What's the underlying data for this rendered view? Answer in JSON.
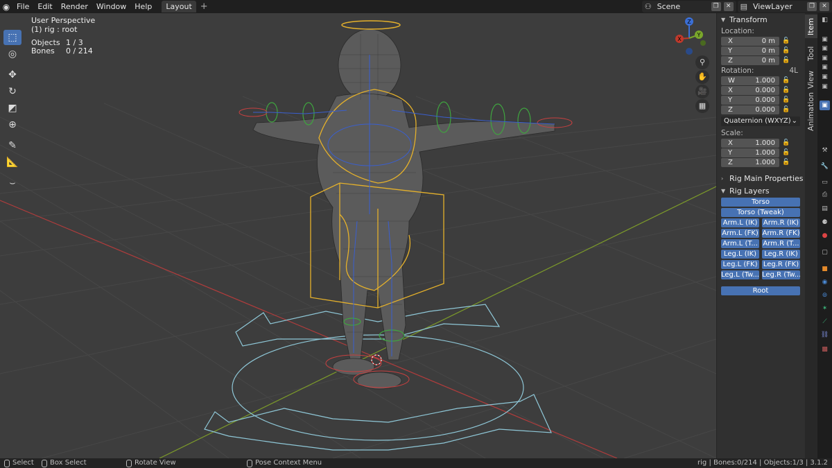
{
  "menu": {
    "items": [
      "File",
      "Edit",
      "Render",
      "Window",
      "Help"
    ],
    "workspace_tab": "Layout",
    "add_tab": "+"
  },
  "scene_selector": {
    "name": "Scene"
  },
  "viewlayer_selector": {
    "name": "ViewLayer"
  },
  "viewport": {
    "view_name": "User Perspective",
    "active_object": "(1) rig : root",
    "objects_label": "Objects",
    "objects_value": "1 / 3",
    "bones_label": "Bones",
    "bones_value": "0 / 214",
    "gizmo_x": "X",
    "gizmo_y": "Y",
    "gizmo_z": "Z",
    "colors": {
      "grid": "#4a4a4a",
      "x_axis": "#b03c3c",
      "y_axis": "#7c9a2a",
      "selection": "#e5b12b",
      "bones": "#3a5fd0"
    }
  },
  "toolbar": {
    "tools": [
      "select-box",
      "cursor",
      "move",
      "rotate",
      "scale",
      "transform",
      "annotate",
      "measure",
      "relax"
    ]
  },
  "transform": {
    "title": "Transform",
    "location_label": "Location:",
    "location": [
      {
        "axis": "X",
        "value": "0 m"
      },
      {
        "axis": "Y",
        "value": "0 m"
      },
      {
        "axis": "Z",
        "value": "0 m"
      }
    ],
    "rotation_label": "Rotation:",
    "rotation_mode_short": "4L",
    "rotation": [
      {
        "axis": "W",
        "value": "1.000"
      },
      {
        "axis": "X",
        "value": "0.000"
      },
      {
        "axis": "Y",
        "value": "0.000"
      },
      {
        "axis": "Z",
        "value": "0.000"
      }
    ],
    "rotation_mode": "Quaternion (WXYZ)",
    "scale_label": "Scale:",
    "scale": [
      {
        "axis": "X",
        "value": "1.000"
      },
      {
        "axis": "Y",
        "value": "1.000"
      },
      {
        "axis": "Z",
        "value": "1.000"
      }
    ]
  },
  "rig_main": {
    "title": "Rig Main Properties"
  },
  "rig_layers": {
    "title": "Rig Layers",
    "torso": "Torso",
    "torso_tweak": "Torso (Tweak)",
    "pairs": [
      [
        "Arm.L (IK)",
        "Arm.R (IK)"
      ],
      [
        "Arm.L (FK)",
        "Arm.R (FK)"
      ],
      [
        "Arm.L (T...",
        "Arm.R (T..."
      ],
      [
        "Leg.L (IK)",
        "Leg.R (IK)"
      ],
      [
        "Leg.L (FK)",
        "Leg.R (FK)"
      ],
      [
        "Leg.L (Tw...",
        "Leg.R (Tw..."
      ]
    ],
    "root": "Root"
  },
  "side_tabs": {
    "item": "Item",
    "tool": "Tool",
    "view": "View",
    "animation": "Animation"
  },
  "statusbar": {
    "select": "Select",
    "box_select": "Box Select",
    "rotate_view": "Rotate View",
    "pose_menu": "Pose Context Menu",
    "info": "rig | Bones:0/214 | Objects:1/3 | 3.1.2"
  }
}
